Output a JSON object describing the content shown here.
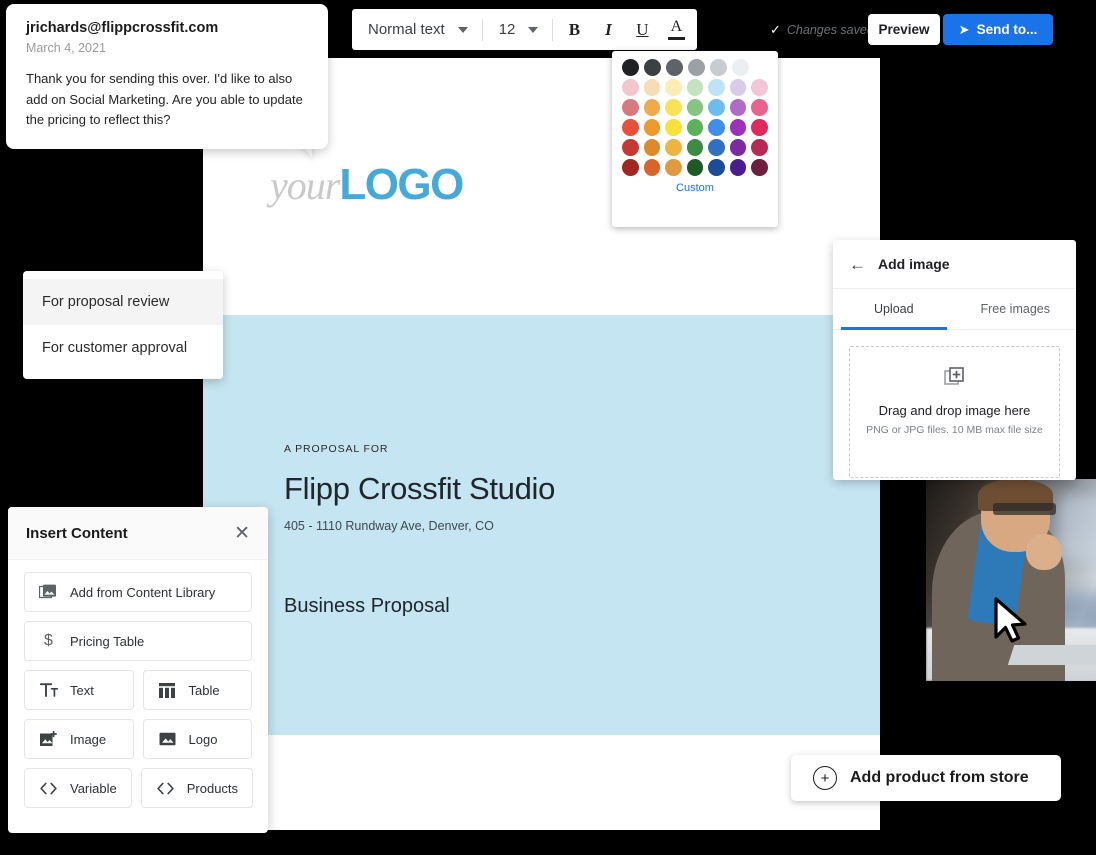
{
  "comment_bubble": {
    "email": "jrichards@flippcrossfit.com",
    "date": "March 4, 2021",
    "message": "Thank you for sending this over. I'd like to also add on Social Marketing. Are you able to update the pricing to reflect this?"
  },
  "toolbar": {
    "style_value": "Normal text",
    "size_value": "12",
    "bold_label": "B",
    "italic_label": "I",
    "underline_label": "U",
    "text_color_label": "A"
  },
  "header": {
    "saved_check": "✓",
    "saved_label": "Changes saved",
    "preview_label": "Preview",
    "send_icon": "➤",
    "send_label": "Send to..."
  },
  "color_palette": {
    "custom_label": "Custom",
    "rows": [
      [
        "#202124",
        "#3c4043",
        "#5f6368",
        "#9aa0a6",
        "#c8ccd0",
        "#eceff1"
      ],
      [
        "#f3c6cd",
        "#f8dcb4",
        "#faeeb5",
        "#c3e2c0",
        "#bfe2f4",
        "#ddcaea",
        "#f3c5d6"
      ],
      [
        "#d9797f",
        "#eeaa4c",
        "#f7e258",
        "#85c581",
        "#6dbcf0",
        "#ae6cc8",
        "#e8648f"
      ],
      [
        "#e8503b",
        "#ec9a2d",
        "#f7e13c",
        "#5cb15a",
        "#3f8ee8",
        "#9a33b8",
        "#e02a5c"
      ],
      [
        "#c43931",
        "#dd8a2c",
        "#eeb441",
        "#3f8b41",
        "#2f70c4",
        "#7b2aa0",
        "#b62b55"
      ],
      [
        "#9f2820",
        "#d9642a",
        "#e09a3e",
        "#1d5a26",
        "#1b4d96",
        "#4a1d8e",
        "#6d1f3f"
      ]
    ]
  },
  "dropdown_menu": {
    "items": [
      {
        "label": "For proposal review",
        "highlighted": true
      },
      {
        "label": "For customer approval",
        "highlighted": false
      }
    ]
  },
  "add_image_panel": {
    "back_icon": "←",
    "title": "Add image",
    "tabs": [
      {
        "label": "Upload",
        "active": true
      },
      {
        "label": "Free images",
        "active": false
      }
    ],
    "dropzone_icon": "add-image-icon",
    "dropzone_title": "Drag and drop image here",
    "dropzone_subtitle": "PNG or JPG files. 10 MB max file size"
  },
  "insert_content_panel": {
    "title": "Insert Content",
    "close_icon": "✕",
    "full_items": [
      {
        "label": "Add from Content Library",
        "icon": "content-library-icon"
      },
      {
        "label": "Pricing Table",
        "icon": "dollar-icon"
      }
    ],
    "grid_items": [
      {
        "label": "Text",
        "icon": "text-icon"
      },
      {
        "label": "Table",
        "icon": "table-icon"
      },
      {
        "label": "Image",
        "icon": "image-icon"
      },
      {
        "label": "Logo",
        "icon": "logo-icon"
      },
      {
        "label": "Variable",
        "icon": "variable-icon"
      },
      {
        "label": "Products",
        "icon": "products-icon"
      }
    ]
  },
  "document": {
    "logo_prefix": "your",
    "logo_name": "LOGO",
    "logo_color": "#45aada",
    "band_color": "#c5e5f2",
    "eyebrow": "A PROPOSAL FOR",
    "title": "Flipp Crossfit Studio",
    "address": "405 - 1110 Rundway Ave, Denver, CO",
    "subtitle": "Business Proposal"
  },
  "add_product_button": {
    "icon": "+",
    "label": "Add product from store"
  }
}
